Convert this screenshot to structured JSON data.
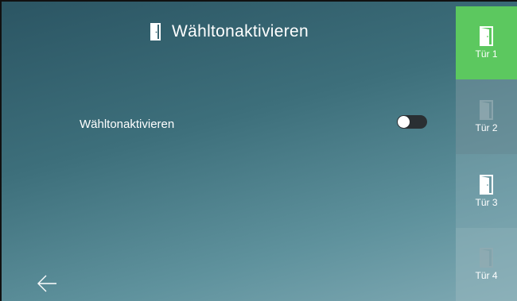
{
  "header": {
    "title": "Wähltonaktivieren",
    "icon": "door-icon"
  },
  "setting": {
    "label": "Wähltonaktivieren",
    "enabled": false
  },
  "nav": {
    "back_icon": "arrow-left-icon"
  },
  "sidebar": {
    "active_color": "#5cc85f",
    "tabs": [
      {
        "label": "Tür 1",
        "active": true
      },
      {
        "label": "Tür 2",
        "active": false
      },
      {
        "label": "Tür 3",
        "active": false
      },
      {
        "label": "Tür 4",
        "active": false
      }
    ]
  }
}
